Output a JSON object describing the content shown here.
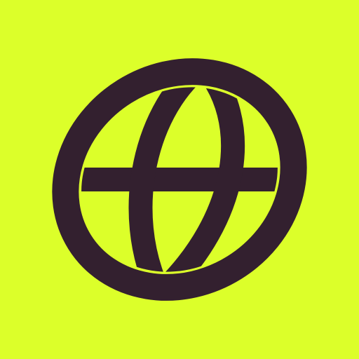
{
  "icon": {
    "name": "globe-icon",
    "background_color": "#dcff2a",
    "glyph_color": "#33202f"
  }
}
